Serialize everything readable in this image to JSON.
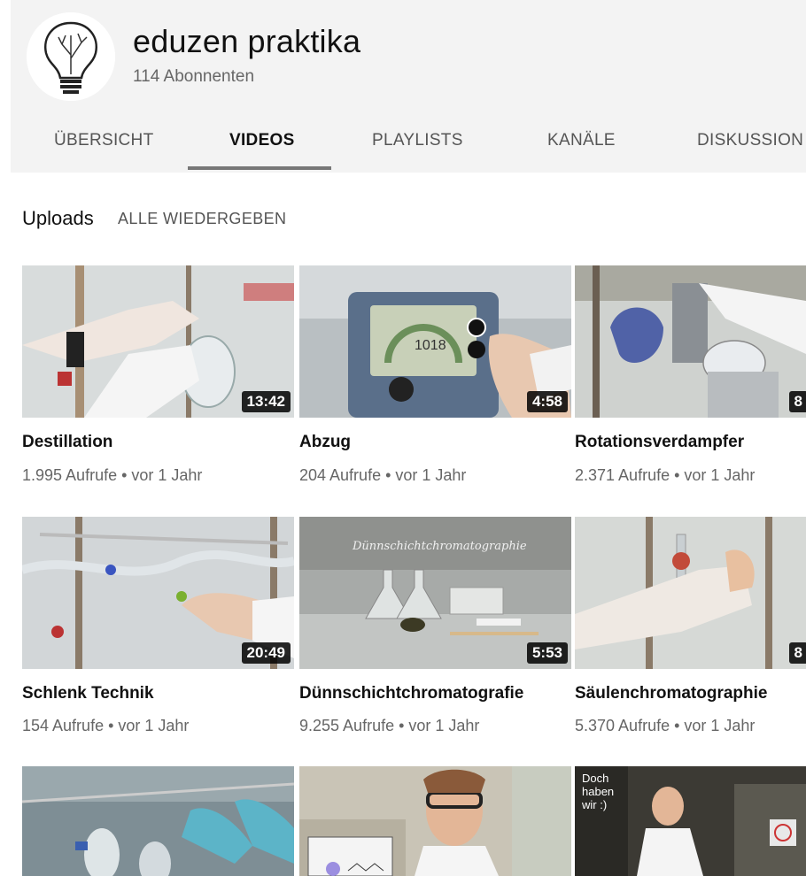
{
  "channel": {
    "name": "eduzen praktika",
    "subscribers": "114 Abonnenten"
  },
  "tabs": [
    "ÜBERSICHT",
    "VIDEOS",
    "PLAYLISTS",
    "KANÄLE",
    "DISKUSSION"
  ],
  "active_tab": "VIDEOS",
  "section": {
    "title": "Uploads",
    "play_all": "ALLE WIEDERGEBEN"
  },
  "videos": [
    {
      "title": "Destillation",
      "meta": "1.995 Aufrufe • vor 1 Jahr",
      "duration": "13:42"
    },
    {
      "title": "Abzug",
      "meta": "204 Aufrufe • vor 1 Jahr",
      "duration": "4:58"
    },
    {
      "title": "Rotationsverdampfer",
      "meta": "2.371 Aufrufe • vor 1 Jahr",
      "duration": "8"
    },
    {
      "title": "Schlenk Technik",
      "meta": "154 Aufrufe • vor 1 Jahr",
      "duration": "20:49"
    },
    {
      "title": "Dünnschichtchromatografie",
      "meta": "9.255 Aufrufe • vor 1 Jahr",
      "duration": "5:53",
      "overlay": "Dünnschichtchromatographie"
    },
    {
      "title": "Säulenchromatographie",
      "meta": "5.370 Aufrufe • vor 1 Jahr",
      "duration": "8"
    }
  ],
  "partial_thumbs": [
    {
      "overlay": "Doch haben wir :)"
    }
  ],
  "thumb_panel": {
    "display": "1018"
  }
}
